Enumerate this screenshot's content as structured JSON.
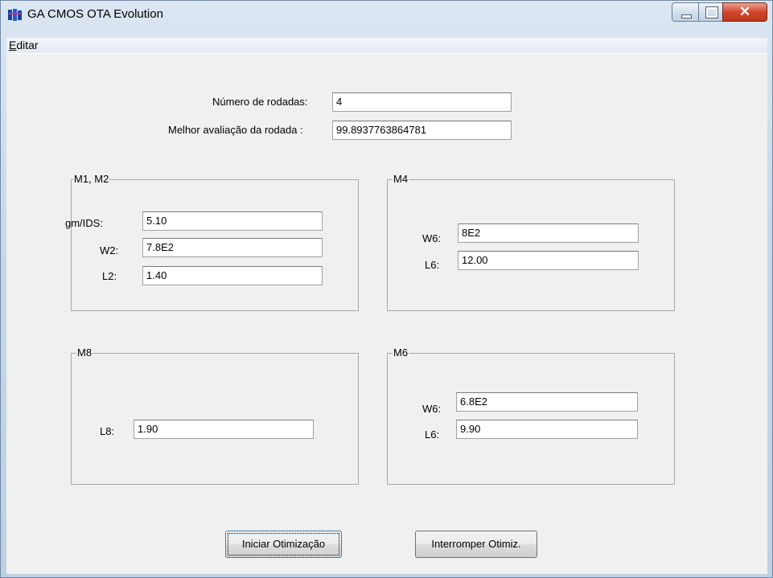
{
  "window": {
    "title": "GA CMOS OTA Evolution"
  },
  "menu": {
    "editar": "Editar",
    "editar_first": "E",
    "editar_rest": "ditar"
  },
  "top": {
    "rodadas_label": "Número de rodadas:",
    "rodadas_value": "4",
    "melhor_label": "Melhor avaliação da rodada :",
    "melhor_value": "99.8937763864781"
  },
  "groups": {
    "m1m2": {
      "title": "M1, M2",
      "gm_label": "gm/IDS:",
      "gm_value": "5.10",
      "w2_label": "W2:",
      "w2_value": "7.8E2",
      "l2_label": "L2:",
      "l2_value": "1.40"
    },
    "m4": {
      "title": "M4",
      "w6_label": "W6:",
      "w6_value": "8E2",
      "l6_label": "L6:",
      "l6_value": "12.00"
    },
    "m8": {
      "title": "M8",
      "l8_label": "L8:",
      "l8_value": "1.90"
    },
    "m6": {
      "title": "M6",
      "w6_label": "W6:",
      "w6_value": "6.8E2",
      "l6_label": "L6:",
      "l6_value": "9.90"
    }
  },
  "buttons": {
    "iniciar": "Iniciar Otimização",
    "interromper": "Interromper Otimiz."
  }
}
